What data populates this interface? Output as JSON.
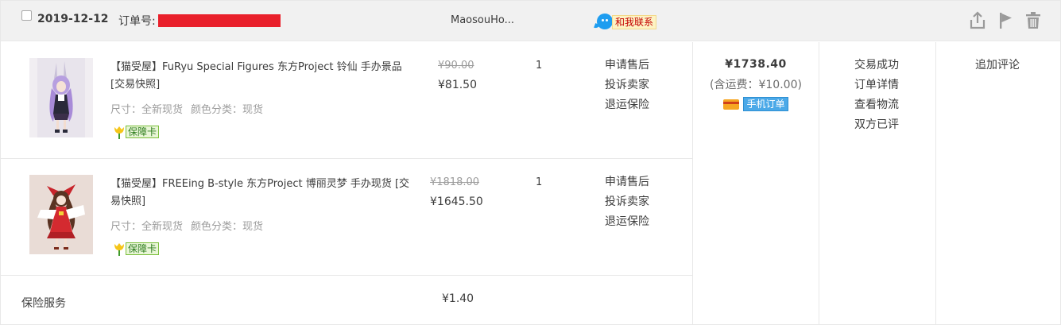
{
  "header": {
    "date": "2019-12-12",
    "order_no_label": "订单号:",
    "shop_name": "MaosouHo...",
    "contact_label": "和我联系",
    "icons": [
      "share-icon",
      "flag-icon",
      "trash-icon"
    ]
  },
  "items": [
    {
      "title": "【猫受屋】FuRyu Special Figures 东方Project 铃仙 手办景品 [交易快照]",
      "sku_size": "尺寸：全新现货",
      "sku_color": "颜色分类：现货",
      "badge": "保障卡",
      "price_original": "¥90.00",
      "price_now": "¥81.50",
      "quantity": "1",
      "ops": [
        "申请售后",
        "投诉卖家",
        "退运保险"
      ]
    },
    {
      "title": "【猫受屋】FREEing B-style 东方Project 博丽灵梦 手办现货 [交易快照]",
      "sku_size": "尺寸：全新现货",
      "sku_color": "颜色分类：现货",
      "badge": "保障卡",
      "price_original": "¥1818.00",
      "price_now": "¥1645.50",
      "quantity": "1",
      "ops": [
        "申请售后",
        "投诉卖家",
        "退运保险"
      ]
    }
  ],
  "insurance": {
    "label": "保险服务",
    "price": "¥1.40"
  },
  "total": {
    "amount": "¥1738.40",
    "shipping": "(含运费：¥10.00)",
    "mobile_tag": "手机订单"
  },
  "status": [
    "交易成功",
    "订单详情",
    "查看物流",
    "双方已评"
  ],
  "extra_action": "追加评论",
  "colors": {
    "header_bg": "#f1f1f1",
    "border": "#e8e8e8",
    "redaction": "#e9202b",
    "contact_text": "#c40000",
    "mobile_tag": "#4ba9e8",
    "badge_green": "#7bbf3b"
  }
}
